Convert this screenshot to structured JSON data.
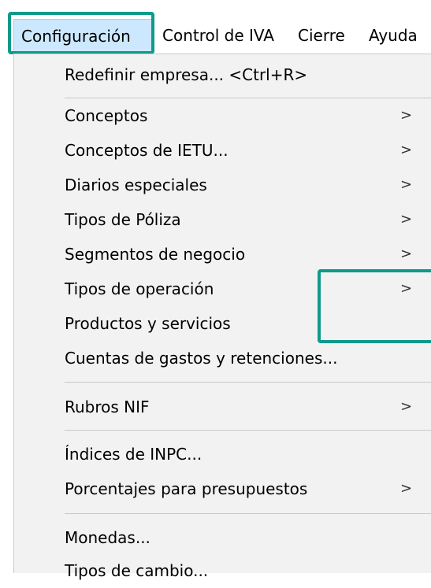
{
  "menubar": {
    "items": [
      {
        "label": "Configuración"
      },
      {
        "label": "Control de IVA"
      },
      {
        "label": "Cierre"
      },
      {
        "label": "Ayuda"
      }
    ]
  },
  "menu": {
    "items": [
      {
        "label": "Redefinir empresa... <Ctrl+R>"
      },
      {
        "label": "Conceptos",
        "submenu": true
      },
      {
        "label": "Conceptos de IETU...",
        "submenu": true
      },
      {
        "label": "Diarios especiales",
        "submenu": true
      },
      {
        "label": "Tipos de Póliza",
        "submenu": true
      },
      {
        "label": "Segmentos de negocio",
        "submenu": true
      },
      {
        "label": "Tipos de operación",
        "submenu": true
      },
      {
        "label": "Productos y servicios"
      },
      {
        "label": "Cuentas de gastos y retenciones..."
      },
      {
        "label": "Rubros NIF",
        "submenu": true
      },
      {
        "label": "Índices de INPC..."
      },
      {
        "label": "Porcentajes para presupuestos",
        "submenu": true
      },
      {
        "label": "Monedas..."
      },
      {
        "label": "Tipos de cambio..."
      }
    ],
    "arrow_glyph": ">"
  },
  "colors": {
    "highlight_outline": "#0e9a8a",
    "menubar_active_bg": "#cce8ff",
    "menu_bg": "#f2f2f2"
  }
}
